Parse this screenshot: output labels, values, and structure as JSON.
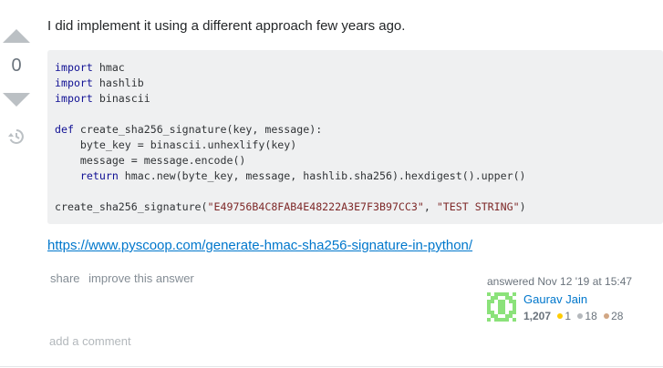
{
  "vote": {
    "count": "0",
    "up_icon": "upvote-arrow-icon",
    "down_icon": "downvote-arrow-icon",
    "history_icon": "history-icon"
  },
  "answer": {
    "text": "I did implement it using a different approach few years ago.",
    "code_lines": [
      "import hmac",
      "import hashlib",
      "import binascii",
      "",
      "def create_sha256_signature(key, message):",
      "    byte_key = binascii.unhexlify(key)",
      "    message = message.encode()",
      "    return hmac.new(byte_key, message, hashlib.sha256).hexdigest().upper()",
      "",
      "create_sha256_signature(\"E49756B4C8FAB4E48222A3E7F3B97CC3\", \"TEST STRING\")"
    ],
    "link": "https://www.pyscoop.com/generate-hmac-sha256-signature-in-python/"
  },
  "menu": {
    "share": "share",
    "improve": "improve this answer"
  },
  "user": {
    "answered": "answered Nov 12 '19 at 15:47",
    "name": "Gaurav Jain",
    "reputation": "1,207",
    "gold": "1",
    "silver": "18",
    "bronze": "28"
  },
  "comments": {
    "add": "add a comment"
  },
  "colors": {
    "link": "#0077cc",
    "code_bg": "#eff0f1",
    "keyword": "#101094",
    "string": "#7d2727",
    "avatar": "#8be27a"
  }
}
